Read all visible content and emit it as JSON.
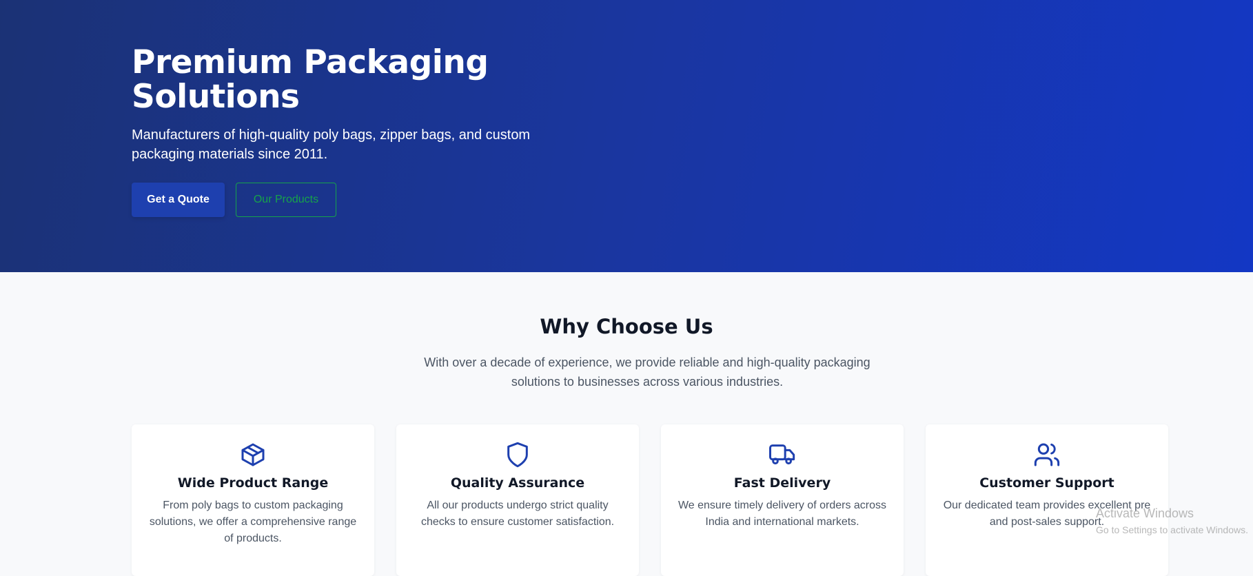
{
  "hero": {
    "title": "Premium Packaging Solutions",
    "subtitle": "Manufacturers of high-quality poly bags, zipper bags, and custom packaging materials since 2011.",
    "primary_button": "Get a Quote",
    "secondary_button": "Our Products"
  },
  "why": {
    "title": "Why Choose Us",
    "description": "With over a decade of experience, we provide reliable and high-quality packaging solutions to businesses across various industries.",
    "cards": [
      {
        "icon": "box-icon",
        "title": "Wide Product Range",
        "text": "From poly bags to custom packaging solutions, we offer a comprehensive range of products."
      },
      {
        "icon": "shield-icon",
        "title": "Quality Assurance",
        "text": "All our products undergo strict quality checks to ensure customer satisfaction."
      },
      {
        "icon": "truck-icon",
        "title": "Fast Delivery",
        "text": "We ensure timely delivery of orders across India and international markets."
      },
      {
        "icon": "users-icon",
        "title": "Customer Support",
        "text": "Our dedicated team provides excellent pre and post-sales support."
      }
    ]
  },
  "watermark": {
    "line1": "Activate Windows",
    "line2": "Go to Settings to activate Windows."
  },
  "colors": {
    "hero_gradient_start": "#1b3275",
    "hero_gradient_end": "#1337c4",
    "primary_button": "#1e40af",
    "outline_button": "#16a34a",
    "icon": "#1e40af"
  }
}
